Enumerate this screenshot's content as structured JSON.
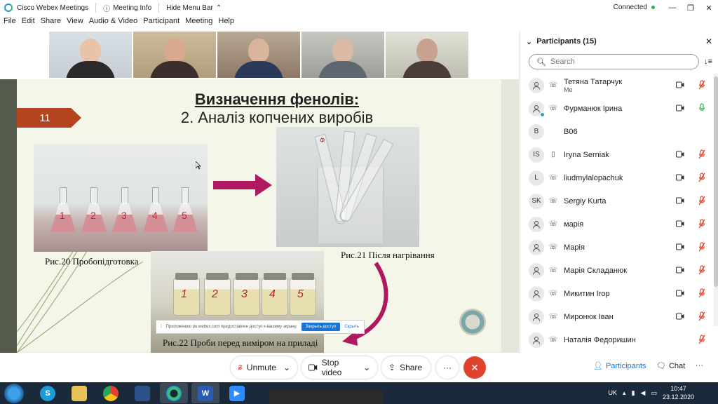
{
  "titlebar": {
    "app_name": "Cisco Webex Meetings",
    "meeting_info": "Meeting Info",
    "hide_menu_bar": "Hide Menu Bar",
    "status": "Connected"
  },
  "menu": [
    "File",
    "Edit",
    "Share",
    "View",
    "Audio & Video",
    "Participant",
    "Meeting",
    "Help"
  ],
  "slide": {
    "number": "11",
    "title": "Визначення фенолів:",
    "subtitle": "2. Аналіз копчених виробів",
    "caption1": "Рис.20 Пробопідготовка",
    "caption2": "Рис.21 Після нагрівання",
    "caption3": "Рис.22 Проби перед виміром на приладі",
    "flask_labels": [
      "1",
      "2",
      "3",
      "4",
      "5"
    ],
    "jar_labels": [
      "1",
      "2",
      "3",
      "4",
      "5"
    ],
    "tube_label": "Ф"
  },
  "share_notice": {
    "text": "Приложению pu.webex.com предоставлен доступ к вашему экрану.",
    "stop_label": "Закрыть доступ",
    "hide_label": "Скрыть"
  },
  "panel": {
    "title": "Participants (15)",
    "search_placeholder": "Search",
    "participants": [
      {
        "initials": "",
        "name": "Тетяна Татарчук",
        "sub": "Me",
        "camera": true,
        "mic_color": "#e0432b"
      },
      {
        "initials": "",
        "name": "Фурманюк Ірина",
        "sub": "",
        "camera": true,
        "mic_color": "#2cb34a"
      },
      {
        "initials": "B",
        "name": "B06",
        "sub": "",
        "camera": false,
        "mic_color": ""
      },
      {
        "initials": "IS",
        "name": "Iryna Serniak",
        "sub": "",
        "camera": true,
        "mic_color": "#e0432b"
      },
      {
        "initials": "L",
        "name": "liudmylalopachuk",
        "sub": "",
        "camera": true,
        "mic_color": "#e0432b"
      },
      {
        "initials": "SK",
        "name": "Sergiy Kurta",
        "sub": "",
        "camera": true,
        "mic_color": "#e0432b"
      },
      {
        "initials": "",
        "name": "марія",
        "sub": "",
        "camera": true,
        "mic_color": "#e0432b"
      },
      {
        "initials": "",
        "name": "Марія",
        "sub": "",
        "camera": true,
        "mic_color": "#e0432b"
      },
      {
        "initials": "",
        "name": "Марія Складанюк",
        "sub": "",
        "camera": true,
        "mic_color": "#e0432b"
      },
      {
        "initials": "",
        "name": "Микитин Ігор",
        "sub": "",
        "camera": true,
        "mic_color": "#e0432b"
      },
      {
        "initials": "",
        "name": "Миронюк Іван",
        "sub": "",
        "camera": true,
        "mic_color": "#e0432b"
      },
      {
        "initials": "",
        "name": "Наталія Федоришин",
        "sub": "",
        "camera": false,
        "mic_color": "#e0432b"
      }
    ]
  },
  "controls": {
    "unmute": "Unmute",
    "stop_video": "Stop video",
    "share": "Share",
    "participants": "Participants",
    "chat": "Chat"
  },
  "taskbar": {
    "lang": "UK",
    "time": "10:47",
    "date": "23.12.2020"
  },
  "colors": {
    "accent": "#1a74d6",
    "end_call": "#e0432b",
    "slide_number_bg": "#b5431f",
    "arrow": "#b0195f"
  }
}
